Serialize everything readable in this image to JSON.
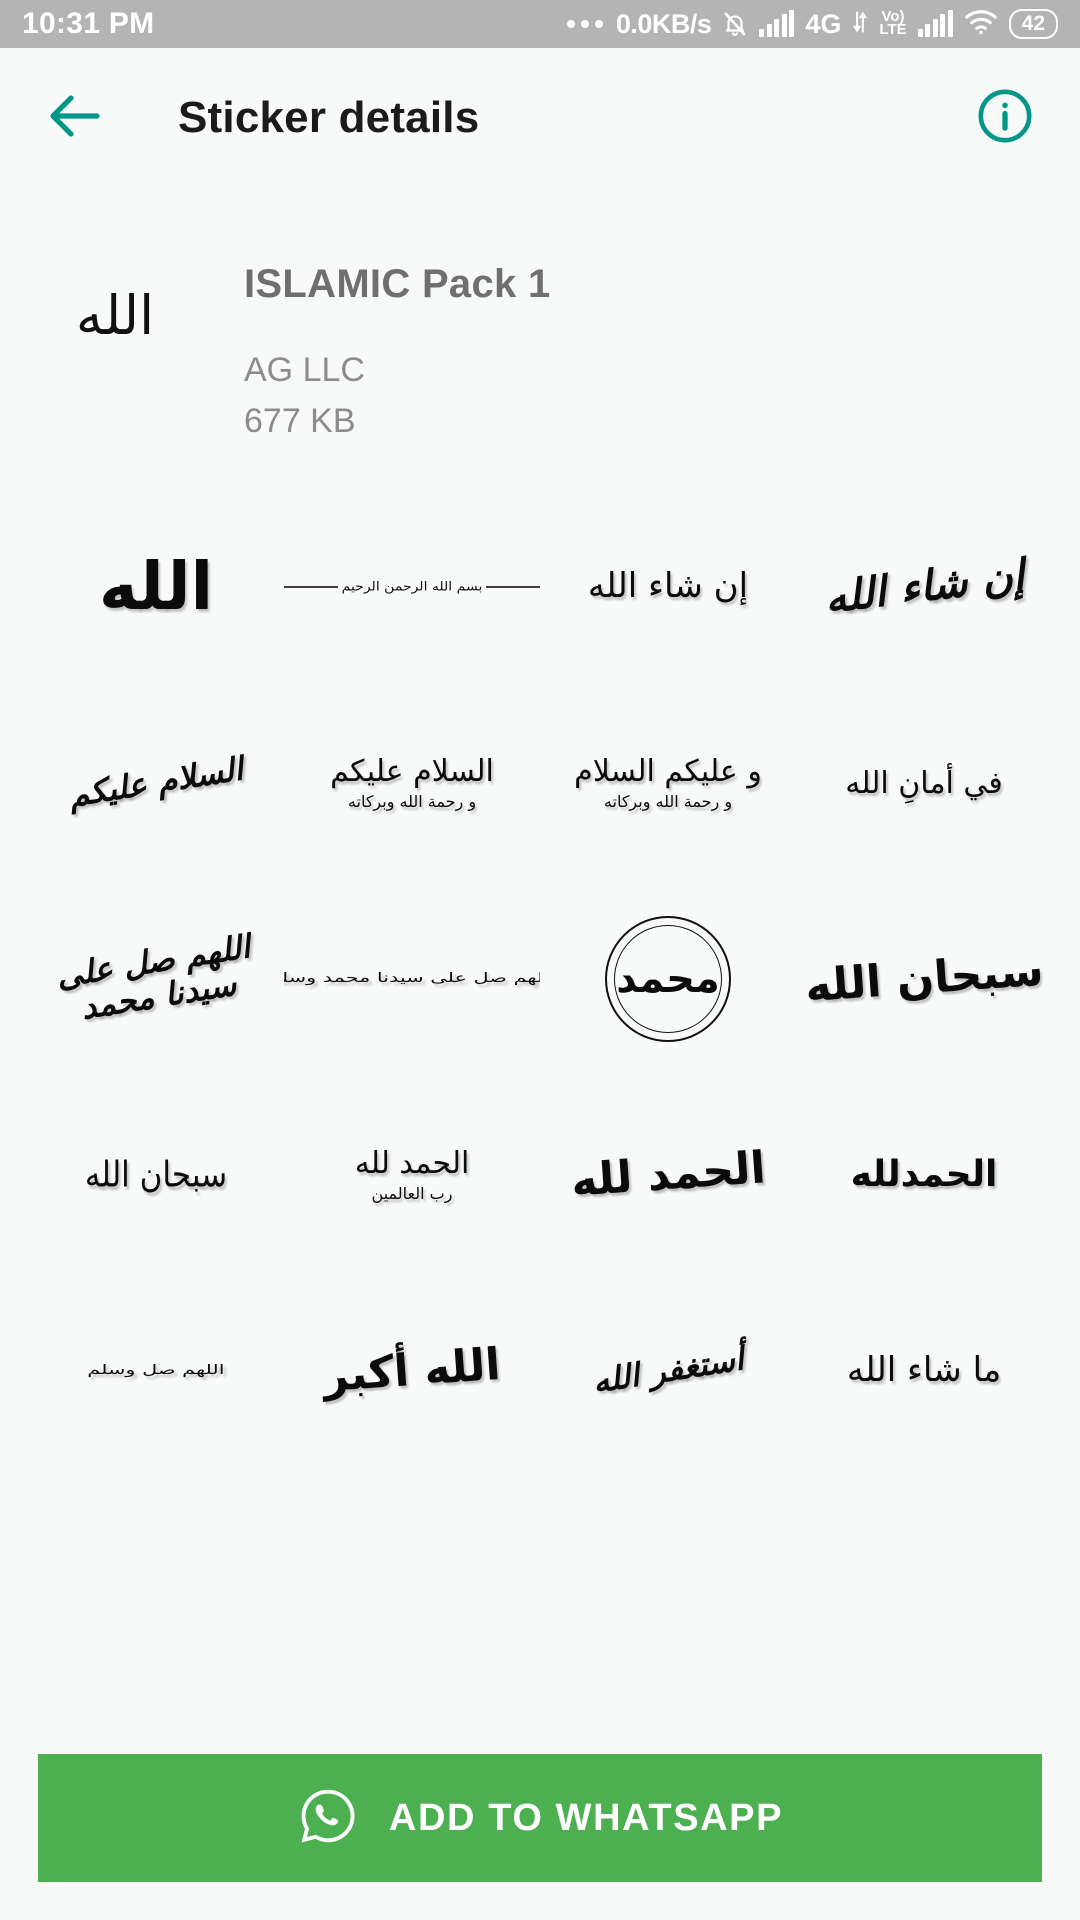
{
  "statusbar": {
    "time": "10:31 PM",
    "overflow_icon": "more-dots-icon",
    "network_speed": "0.0KB/s",
    "mute_icon": "bell-muted-icon",
    "signal1_icon": "signal-bars-icon",
    "network_type": "4G",
    "data_arrows_icon": "data-transfer-icon",
    "volte_top": "Vo)",
    "volte_bottom": "LTE",
    "signal2_icon": "signal-bars-icon",
    "wifi_icon": "wifi-icon",
    "battery_level": "42"
  },
  "appbar": {
    "back_icon": "back-arrow-icon",
    "title": "Sticker details",
    "info_icon": "info-circle-icon",
    "accent_color": "#009688"
  },
  "pack": {
    "thumbnail_text": "الله",
    "name": "ISLAMIC Pack 1",
    "publisher": "AG LLC",
    "size": "677 KB"
  },
  "stickers": [
    {
      "main": "الله",
      "sub": "",
      "style": "v-huge"
    },
    {
      "main": "بسم الله الرحمن الرحيم",
      "sub": "",
      "style": "bismillah"
    },
    {
      "main": "إن شاء الله",
      "sub": "",
      "style": "v-plain"
    },
    {
      "main": "إن شاء الله",
      "sub": "",
      "style": "v-callig"
    },
    {
      "main": "السلام عليكم",
      "sub": "",
      "style": "v-callig2"
    },
    {
      "main": "السلام عليكم",
      "sub": "و رحمة الله وبركاته",
      "style": "v-stack"
    },
    {
      "main": "و عليكم السلام",
      "sub": "و رحمة الله وبركاته",
      "style": "v-stack"
    },
    {
      "main": "في أمانِ الله",
      "sub": "",
      "style": "v-plain2"
    },
    {
      "main": "اللهم صل على سيدنا محمد",
      "sub": "",
      "style": "v-callig2"
    },
    {
      "main": "اللهم صل على سيدنا محمد وسلم",
      "sub": "",
      "style": "v-tiny"
    },
    {
      "main": "محمد",
      "sub": "",
      "style": "medallion"
    },
    {
      "main": "سبحان الله",
      "sub": "",
      "style": "v-callig3"
    },
    {
      "main": "سبحان الله",
      "sub": "",
      "style": "v-thin"
    },
    {
      "main": "الحمد لله",
      "sub": "رب العالمين",
      "style": "v-stack"
    },
    {
      "main": "الحمد لله",
      "sub": "",
      "style": "v-callig3"
    },
    {
      "main": "الحمدلله",
      "sub": "",
      "style": "v-bold"
    },
    {
      "main": "اللهم صل وسلم",
      "sub": "",
      "style": "v-tiny"
    },
    {
      "main": "الله أكبر",
      "sub": "",
      "style": "v-callig3"
    },
    {
      "main": "أستغفر الله",
      "sub": "",
      "style": "v-callig2"
    },
    {
      "main": "ما شاء الله",
      "sub": "",
      "style": "v-plain"
    }
  ],
  "cta": {
    "whatsapp_icon": "whatsapp-icon",
    "label": "ADD TO WHATSAPP",
    "color": "#4caf50"
  }
}
